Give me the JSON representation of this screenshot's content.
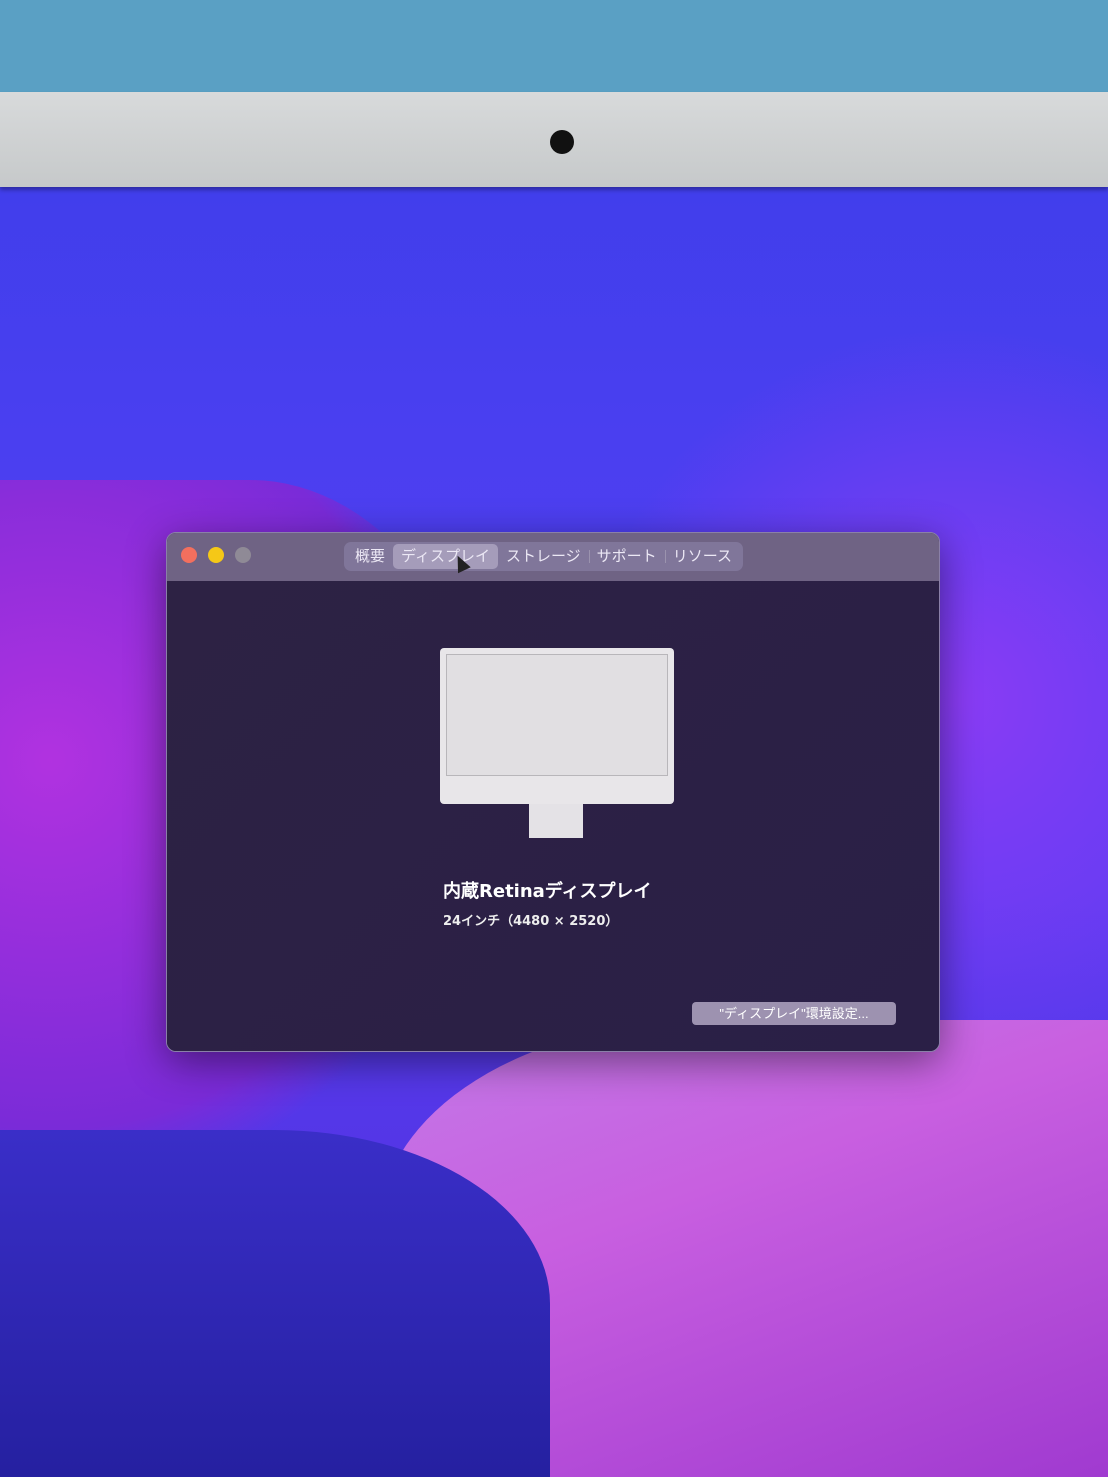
{
  "window": {
    "tabs": [
      {
        "label": "概要",
        "selected": false
      },
      {
        "label": "ディスプレイ",
        "selected": true
      },
      {
        "label": "ストレージ",
        "selected": false
      },
      {
        "label": "サポート",
        "selected": false
      },
      {
        "label": "リソース",
        "selected": false
      }
    ],
    "display": {
      "name": "内蔵Retinaディスプレイ",
      "spec": "24インチ（4480 × 2520）"
    },
    "prefs_button": "\"ディスプレイ\"環境設定..."
  },
  "colors": {
    "close": "#f36f5e",
    "minimize": "#f5c817",
    "zoom": "#8f8a96"
  }
}
